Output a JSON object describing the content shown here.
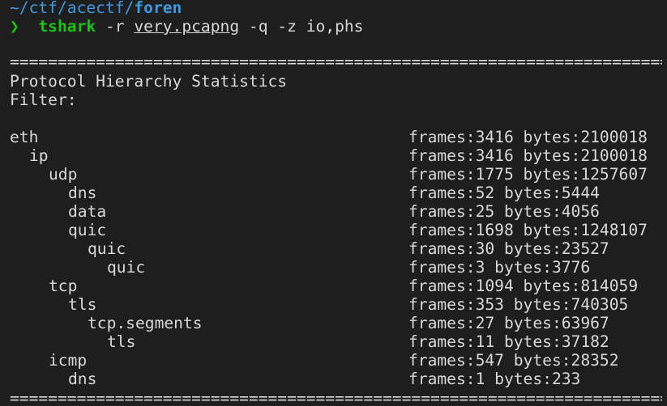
{
  "prompt": {
    "path_prefix": "~/ctf/acectf/",
    "path_current": "foren",
    "symbol": "❯",
    "command": "tshark",
    "args_before": "-r",
    "file": "very.pcapng",
    "args_after": "-q -z io,phs"
  },
  "output": {
    "separator": "=================================================================================",
    "title": "Protocol Hierarchy Statistics",
    "filter_label": "Filter:",
    "rows": [
      {
        "protocol": "eth",
        "depth": 0,
        "stats": "frames:3416 bytes:2100018"
      },
      {
        "protocol": "ip",
        "depth": 1,
        "stats": "frames:3416 bytes:2100018"
      },
      {
        "protocol": "udp",
        "depth": 2,
        "stats": "frames:1775 bytes:1257607"
      },
      {
        "protocol": "dns",
        "depth": 3,
        "stats": "frames:52 bytes:5444"
      },
      {
        "protocol": "data",
        "depth": 3,
        "stats": "frames:25 bytes:4056"
      },
      {
        "protocol": "quic",
        "depth": 3,
        "stats": "frames:1698 bytes:1248107"
      },
      {
        "protocol": "quic",
        "depth": 4,
        "stats": "frames:30 bytes:23527"
      },
      {
        "protocol": "quic",
        "depth": 5,
        "stats": "frames:3 bytes:3776"
      },
      {
        "protocol": "tcp",
        "depth": 2,
        "stats": "frames:1094 bytes:814059"
      },
      {
        "protocol": "tls",
        "depth": 3,
        "stats": "frames:353 bytes:740305"
      },
      {
        "protocol": "tcp.segments",
        "depth": 4,
        "stats": "frames:27 bytes:63967"
      },
      {
        "protocol": "tls",
        "depth": 5,
        "stats": "frames:11 bytes:37182"
      },
      {
        "protocol": "icmp",
        "depth": 2,
        "stats": "frames:547 bytes:28352"
      },
      {
        "protocol": "dns",
        "depth": 3,
        "stats": "frames:1 bytes:233"
      }
    ]
  }
}
